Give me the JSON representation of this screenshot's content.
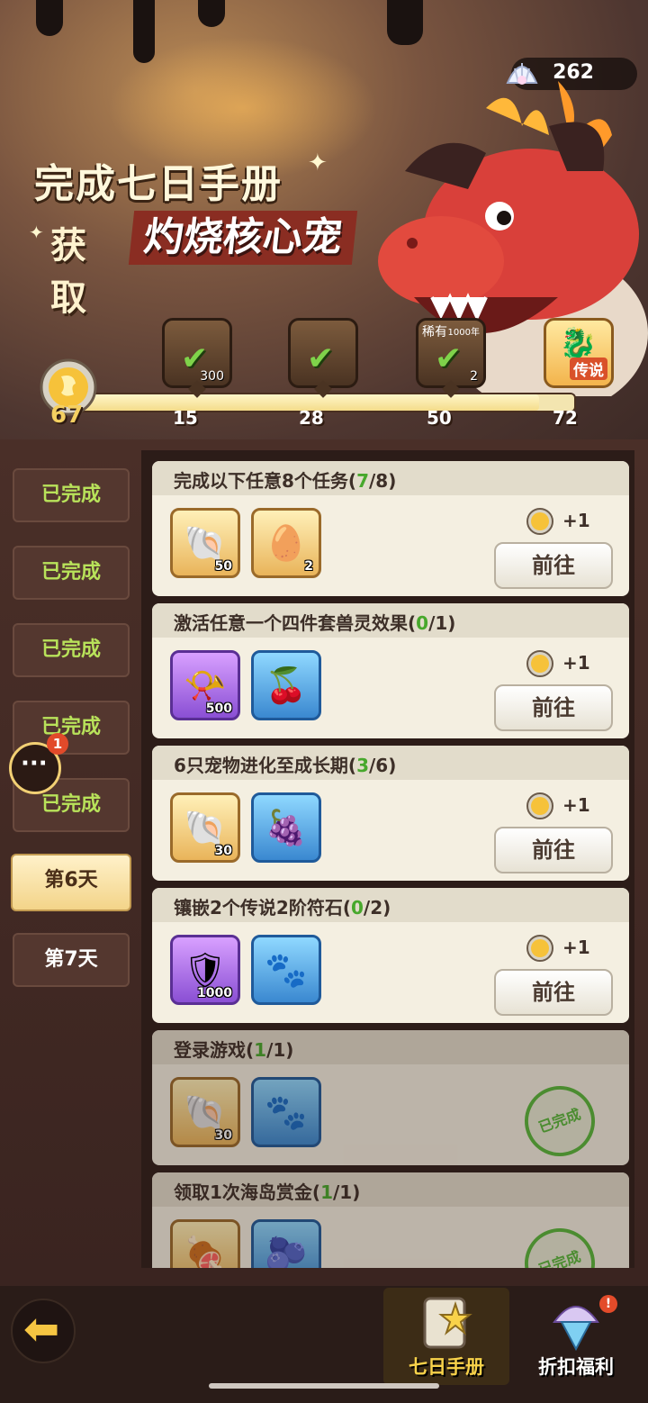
{
  "currency": {
    "icon": "pearl-shell-icon",
    "value": "262"
  },
  "banner": {
    "title_line1": "完成七日手册",
    "title_line2_prefix": "获取",
    "title_line2_highlight": "灼烧核心宠"
  },
  "progress": {
    "current": "67",
    "fraction": 0.93,
    "milestones": [
      {
        "value": "15",
        "claimed": true,
        "count": "300",
        "icon": "shell-reward-icon"
      },
      {
        "value": "28",
        "claimed": true,
        "count": "",
        "icon": "ore-reward-icon"
      },
      {
        "value": "50",
        "claimed": true,
        "count": "2",
        "tag": "稀有",
        "tag2": "1000年",
        "icon": "stone-reward-icon"
      },
      {
        "value": "72",
        "claimed": false,
        "legend": "传说",
        "icon": "dragon-pet-icon"
      }
    ]
  },
  "days": [
    {
      "label": "已完成",
      "state": "done"
    },
    {
      "label": "已完成",
      "state": "done"
    },
    {
      "label": "已完成",
      "state": "done"
    },
    {
      "label": "已完成",
      "state": "done"
    },
    {
      "label": "已完成",
      "state": "done"
    },
    {
      "label": "第6天",
      "state": "active"
    },
    {
      "label": "第7天",
      "state": "locked"
    }
  ],
  "tasks": [
    {
      "title": "完成以下任意8个任务(",
      "progress": "7",
      "total": "/8)",
      "items": [
        {
          "qty": "50",
          "type": "gold",
          "icon": "shell-icon"
        },
        {
          "qty": "2",
          "type": "gold",
          "icon": "golden-egg-icon"
        }
      ],
      "reward": "+1",
      "button": "前往",
      "done": false
    },
    {
      "title": "激活任意一个四件套兽灵效果(",
      "progress": "0",
      "total": "/1)",
      "items": [
        {
          "qty": "500",
          "type": "purple",
          "icon": "horn-icon"
        },
        {
          "qty": "",
          "type": "blue",
          "icon": "red-fruit-icon"
        }
      ],
      "reward": "+1",
      "button": "前往",
      "done": false
    },
    {
      "title": "6只宠物进化至成长期(",
      "progress": "3",
      "total": "/6)",
      "items": [
        {
          "qty": "30",
          "type": "gold",
          "icon": "shell-icon"
        },
        {
          "qty": "",
          "type": "blue",
          "icon": "grape-icon"
        }
      ],
      "reward": "+1",
      "button": "前往",
      "done": false
    },
    {
      "title": "镶嵌2个传说2阶符石(",
      "progress": "0",
      "total": "/2)",
      "items": [
        {
          "qty": "1000",
          "type": "purple",
          "icon": "shield-badge-icon"
        },
        {
          "qty": "",
          "type": "blue",
          "icon": "paw-stone-icon"
        }
      ],
      "reward": "+1",
      "button": "前往",
      "done": false
    },
    {
      "title": "登录游戏(",
      "progress": "1",
      "total": "/1)",
      "items": [
        {
          "qty": "30",
          "type": "gold",
          "icon": "shell-icon"
        },
        {
          "qty": "",
          "type": "blue",
          "icon": "paw-stone-icon"
        }
      ],
      "reward": "",
      "button": "",
      "stamp": "已完成",
      "done": true
    },
    {
      "title": "领取1次海岛赏金(",
      "progress": "1",
      "total": "/1)",
      "items": [
        {
          "qty": "",
          "type": "gold",
          "icon": "meat-icon"
        },
        {
          "qty": "",
          "type": "blue",
          "icon": "blue-fruit-icon"
        }
      ],
      "reward": "",
      "button": "",
      "stamp": "已完成",
      "done": true
    }
  ],
  "chat": {
    "badge": "1"
  },
  "bottom_nav": [
    {
      "label": "七日手册",
      "active": true,
      "icon": "handbook-icon"
    },
    {
      "label": "折扣福利",
      "active": false,
      "icon": "gift-shell-icon",
      "badge": "!"
    }
  ],
  "colors": {
    "accent_green": "#47a82c",
    "gold": "#f5d061",
    "stamp_green": "#58b83a"
  }
}
